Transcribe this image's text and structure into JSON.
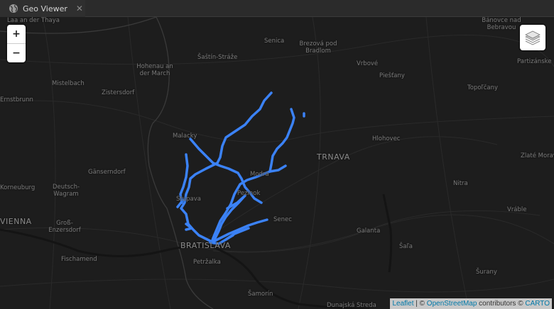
{
  "app": {
    "tab_title": "Geo Viewer"
  },
  "map": {
    "controls": {
      "zoom_in": "+",
      "zoom_out": "−"
    },
    "attribution": {
      "leaflet": "Leaflet",
      "sep1": " | © ",
      "osm": "OpenStreetMap",
      "mid": " contributors © ",
      "carto": "CARTO"
    },
    "labels": [
      "Laa an der Thaya",
      "Bánovce nad Bebravou",
      "Senica",
      "Brezová pod Bradlom",
      "Šaštín-Stráže",
      "Hohenau an der March",
      "Vrbové",
      "Piešťany",
      "Partizánske",
      "Mistelbach",
      "Zistersdorf",
      "Topoľčany",
      "Ernstbrunn",
      "Malacky",
      "Hlohovec",
      "TRNAVA",
      "Zlaté Moravce",
      "Gänserndorf",
      "Modra",
      "Korneuburg",
      "Deutsch-Wagram",
      "Pezinok",
      "Nitra",
      "Stupava",
      "Vráble",
      "VIENNA",
      "Groß-Enzersdorf",
      "Senec",
      "Galanta",
      "BRATISLAVA",
      "Šaľa",
      "Fischamend",
      "Petržalka",
      "Šurany",
      "Šamorín",
      "Dunajská Streda"
    ],
    "colors": {
      "route": "#3b82f6",
      "background": "#1d1d1d",
      "borders": "#3a3a3a",
      "roads": "#2c2c2c"
    }
  }
}
